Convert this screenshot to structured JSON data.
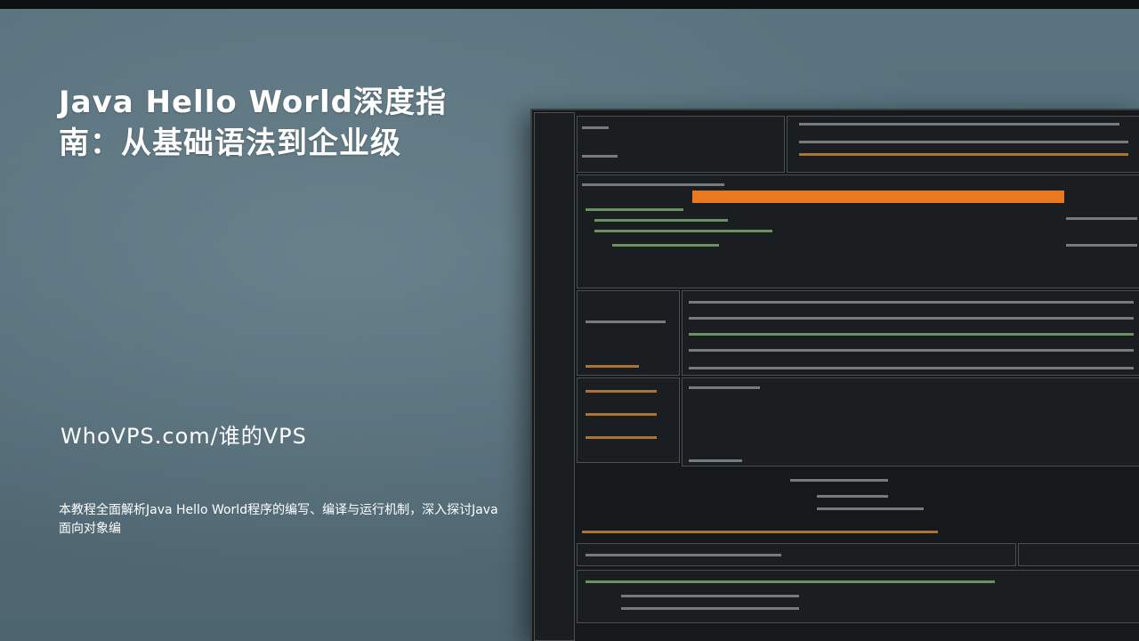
{
  "headline": "Java Hello World深度指南：从基础语法到企业级",
  "site": "WhoVPS.com/谁的VPS",
  "description": "本教程全面解析Java Hello World程序的编写、编译与运行机制，深入探讨Java面向对象编"
}
